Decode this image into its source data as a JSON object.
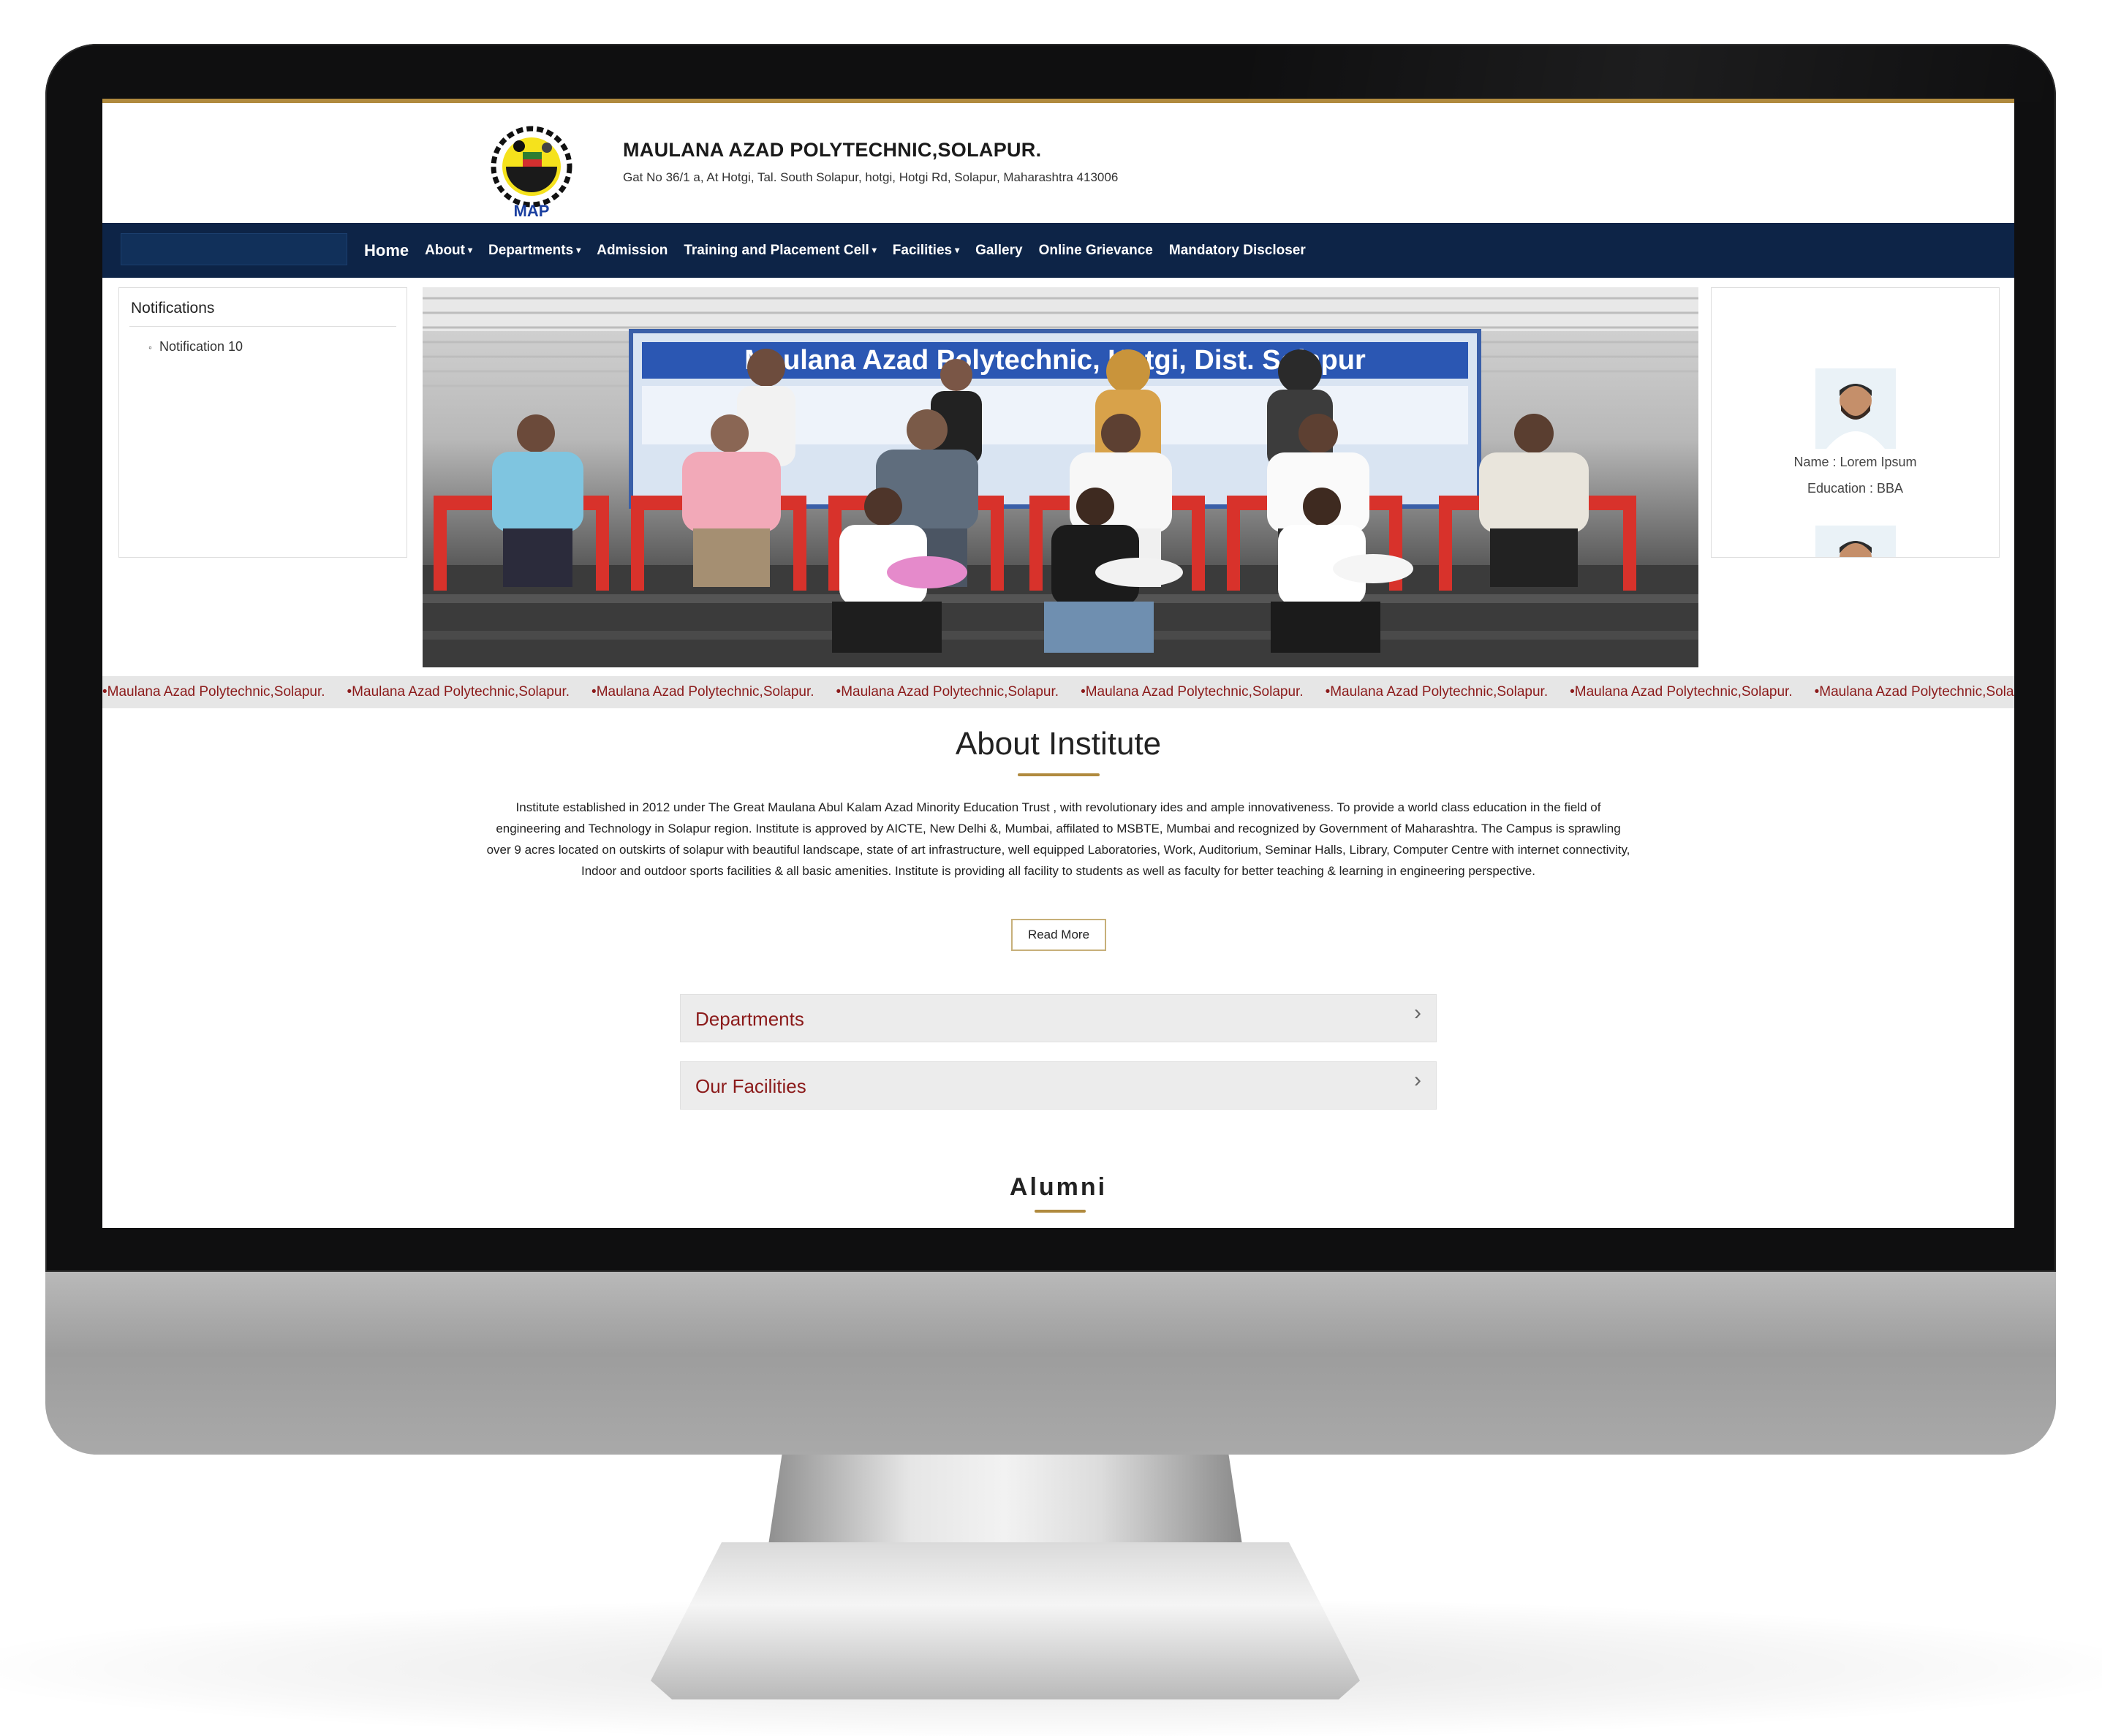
{
  "header": {
    "title": "MAULANA AZAD POLYTECHNIC,SOLAPUR.",
    "address": "Gat No 36/1 a, At Hotgi, Tal. South Solapur, hotgi, Hotgi Rd, Solapur, Maharashtra 413006",
    "logo_text": "MAP"
  },
  "nav": {
    "items": [
      {
        "label": "Home",
        "dropdown": false
      },
      {
        "label": "About",
        "dropdown": true
      },
      {
        "label": "Departments",
        "dropdown": true
      },
      {
        "label": "Admission",
        "dropdown": false
      },
      {
        "label": "Training and Placement Cell",
        "dropdown": true
      },
      {
        "label": "Facilities",
        "dropdown": true
      },
      {
        "label": "Gallery",
        "dropdown": false
      },
      {
        "label": "Online Grievance",
        "dropdown": false
      },
      {
        "label": "Mandatory Discloser",
        "dropdown": false
      }
    ]
  },
  "notifications": {
    "title": "Notifications",
    "items": [
      "Notification 10"
    ]
  },
  "hero": {
    "banner_text": "Maulana Azad Polytechnic, Hotgi, Dist. Solapur"
  },
  "alumni_card": {
    "name": "Name : Lorem Ipsum",
    "education": "Education : BBA"
  },
  "marquee": {
    "items": [
      "Maulana Azad Polytechnic,Solapur.",
      "Maulana Azad Polytechnic,Solapur.",
      "Maulana Azad Polytechnic,Solapur.",
      "Maulana Azad Polytechnic,Solapur.",
      "Maulana Azad Polytechnic,Solapur.",
      "Maulana Azad Polytechnic,Solapur.",
      "Maulana Azad Polytechnic,Solapur.",
      "Maulana Azad Polytechnic,Solapur."
    ]
  },
  "about": {
    "title": "About Institute",
    "text": "Institute established in 2012 under The Great Maulana Abul Kalam Azad Minority Education Trust , with revolutionary ides and ample innovativeness. To provide a world class education in the field of engineering and Technology in Solapur region. Institute is approved by AICTE, New Delhi &, Mumbai, affilated to MSBTE, Mumbai and recognized by Government of Maharashtra. The Campus is sprawling over 9 acres located on outskirts of solapur with beautiful landscape, state of art infrastructure, well equipped Laboratories, Work, Auditorium, Seminar Halls, Library, Computer Centre with internet connectivity, Indoor and outdoor sports facilities & all basic amenities. Institute is providing all facility to students as well as faculty for better teaching & learning in engineering perspective.",
    "read_more": "Read More"
  },
  "accordion": [
    {
      "label": "Departments"
    },
    {
      "label": "Our Facilities"
    }
  ],
  "alumni_section": {
    "title": "Alumni"
  },
  "colors": {
    "navbar": "#0d2447",
    "accent_gold": "#b08a3e",
    "maroon": "#8b1a1a"
  }
}
